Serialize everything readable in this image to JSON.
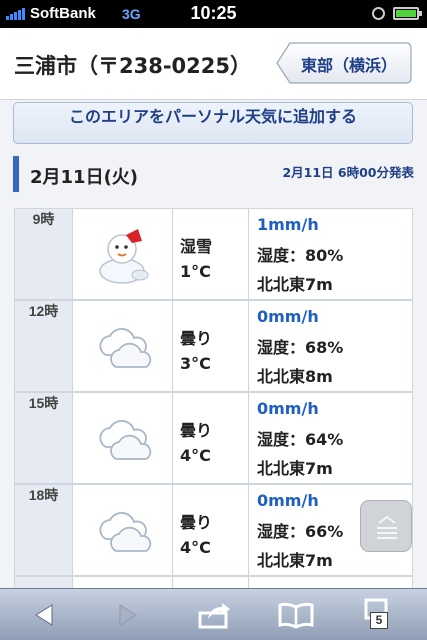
{
  "status_bar": {
    "carrier": "SoftBank",
    "network": "3G",
    "time": "10:25",
    "signal_icon": "signal-bars-icon",
    "battery_icon": "battery-icon"
  },
  "header": {
    "location": "三浦市（〒238-0225）",
    "region_button": "東部（横浜）"
  },
  "add_area_button": "このエリアをパーソナル天気に追加する",
  "date": {
    "day": "2月11日(火)",
    "published": "2月11日 6時00分発表"
  },
  "colors": {
    "accent": "#3a66c4",
    "link": "#1f3f86",
    "rain_text": "#1f5fbf"
  },
  "forecast": [
    {
      "hour": "9時",
      "icon": "snowman-icon",
      "weather": "湿雪",
      "temp": "1°C",
      "rain": "1mm/h",
      "humidity": "湿度：80%",
      "wind": "北北東7m"
    },
    {
      "hour": "12時",
      "icon": "cloud-icon",
      "weather": "曇り",
      "temp": "3°C",
      "rain": "0mm/h",
      "humidity": "湿度：68%",
      "wind": "北北東8m"
    },
    {
      "hour": "15時",
      "icon": "cloud-icon",
      "weather": "曇り",
      "temp": "4°C",
      "rain": "0mm/h",
      "humidity": "湿度：64%",
      "wind": "北北東7m"
    },
    {
      "hour": "18時",
      "icon": "cloud-icon",
      "weather": "曇り",
      "temp": "4°C",
      "rain": "0mm/h",
      "humidity": "湿度：66%",
      "wind": "北北東7m"
    }
  ],
  "toolbar": {
    "back_icon": "back-arrow-icon",
    "forward_icon": "forward-arrow-icon",
    "share_icon": "share-icon",
    "bookmarks_icon": "bookmarks-icon",
    "tabs_icon": "tabs-icon",
    "tab_count": "5"
  }
}
